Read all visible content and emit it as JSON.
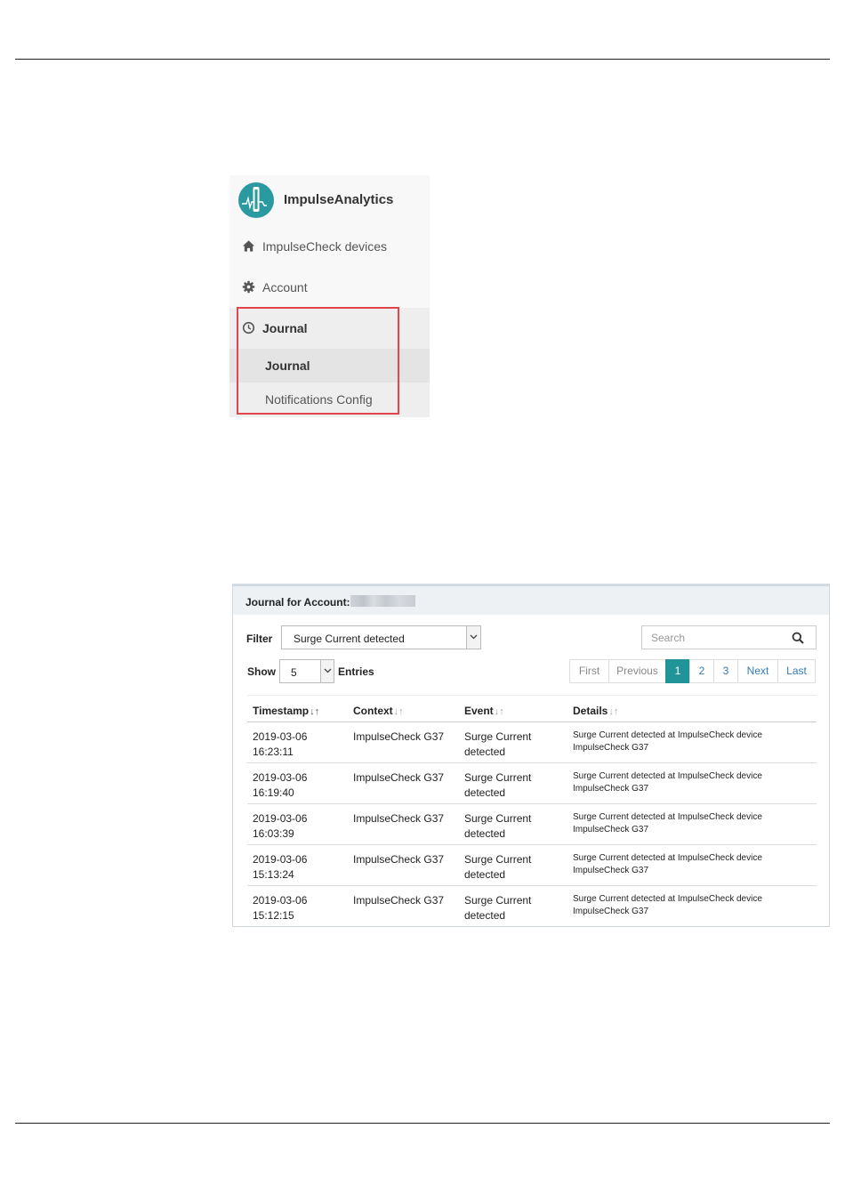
{
  "sidebar": {
    "brand": "ImpulseAnalytics",
    "items": [
      {
        "label": "ImpulseCheck devices",
        "icon": "home-icon"
      },
      {
        "label": "Account",
        "icon": "gear-icon"
      },
      {
        "label": "Journal",
        "icon": "clock-icon"
      }
    ],
    "subitems": [
      {
        "label": "Journal"
      },
      {
        "label": "Notifications Config"
      }
    ],
    "colors": {
      "accent": "#2a9aa0",
      "highlight": "#e4444c"
    }
  },
  "journal": {
    "title": "Journal for Account:",
    "filter_label": "Filter",
    "filter_value": "Surge Current detected",
    "search_placeholder": "Search",
    "show_label": "Show",
    "show_value": "5",
    "entries_label": "Entries",
    "pagination": [
      "First",
      "Previous",
      "1",
      "2",
      "3",
      "Next",
      "Last"
    ],
    "active_page": "1",
    "columns": [
      "Timestamp",
      "Context",
      "Event",
      "Details"
    ],
    "rows": [
      {
        "date": "2019-03-06",
        "time": "16:23:11",
        "context": "ImpulseCheck G37",
        "event1": "Surge Current",
        "event2": "detected",
        "details1": "Surge Current detected at ImpulseCheck device",
        "details2": "ImpulseCheck G37"
      },
      {
        "date": "2019-03-06",
        "time": "16:19:40",
        "context": "ImpulseCheck G37",
        "event1": "Surge Current",
        "event2": "detected",
        "details1": "Surge Current detected at ImpulseCheck device",
        "details2": "ImpulseCheck G37"
      },
      {
        "date": "2019-03-06",
        "time": "16:03:39",
        "context": "ImpulseCheck G37",
        "event1": "Surge Current",
        "event2": "detected",
        "details1": "Surge Current detected at ImpulseCheck device",
        "details2": "ImpulseCheck G37"
      },
      {
        "date": "2019-03-06",
        "time": "15:13:24",
        "context": "ImpulseCheck G37",
        "event1": "Surge Current",
        "event2": "detected",
        "details1": "Surge Current detected at ImpulseCheck device",
        "details2": "ImpulseCheck G37"
      },
      {
        "date": "2019-03-06",
        "time": "15:12:15",
        "context": "ImpulseCheck G37",
        "event1": "Surge Current",
        "event2": "detected",
        "details1": "Surge Current detected at ImpulseCheck device",
        "details2": "ImpulseCheck G37"
      }
    ],
    "colors": {
      "active_page": "#21949a",
      "link": "#337ab7"
    }
  }
}
